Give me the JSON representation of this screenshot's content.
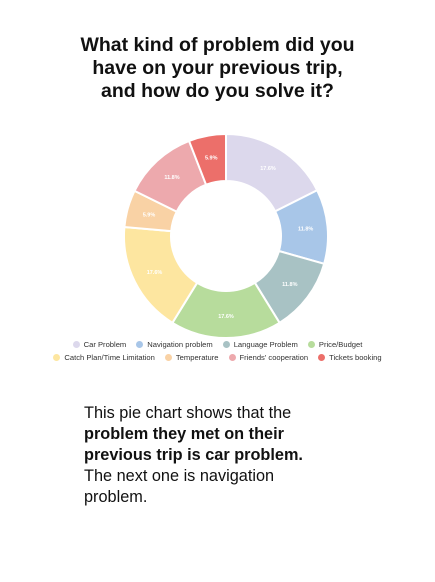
{
  "title_lines": [
    "What kind of problem did you",
    "have on your previous trip,",
    "and how do you solve it?"
  ],
  "chart_data": {
    "type": "pie",
    "title": "What kind of problem did you have on your previous trip, and how do you solve it?",
    "donut": true,
    "legend_placement": "bottom",
    "categories": [
      "Car Problem",
      "Navigation problem",
      "Language Problem",
      "Price/Budget",
      "Catch Plan/Time Limitation",
      "Temperature",
      "Friends' cooperation",
      "Tickets booking"
    ],
    "values": [
      17.6,
      11.8,
      11.8,
      17.6,
      17.6,
      5.9,
      11.8,
      5.9
    ],
    "labels": [
      "17.6%",
      "11.8%",
      "11.8%",
      "17.6%",
      "17.6%",
      "5.9%",
      "11.8%",
      "5.9%"
    ],
    "colors": [
      "#dcd8ec",
      "#a8c6e8",
      "#a8c2c4",
      "#b7dc9c",
      "#fde6a0",
      "#f9d2a5",
      "#eda9ad",
      "#ec6f6a"
    ]
  },
  "legend_rows": [
    [
      0,
      1,
      2,
      3
    ],
    [
      4,
      5,
      6,
      7
    ]
  ],
  "description": {
    "before": "This pie chart shows that the ",
    "bold": "problem they met on their previous trip is car problem.",
    "after": " The next one is navigation problem."
  }
}
